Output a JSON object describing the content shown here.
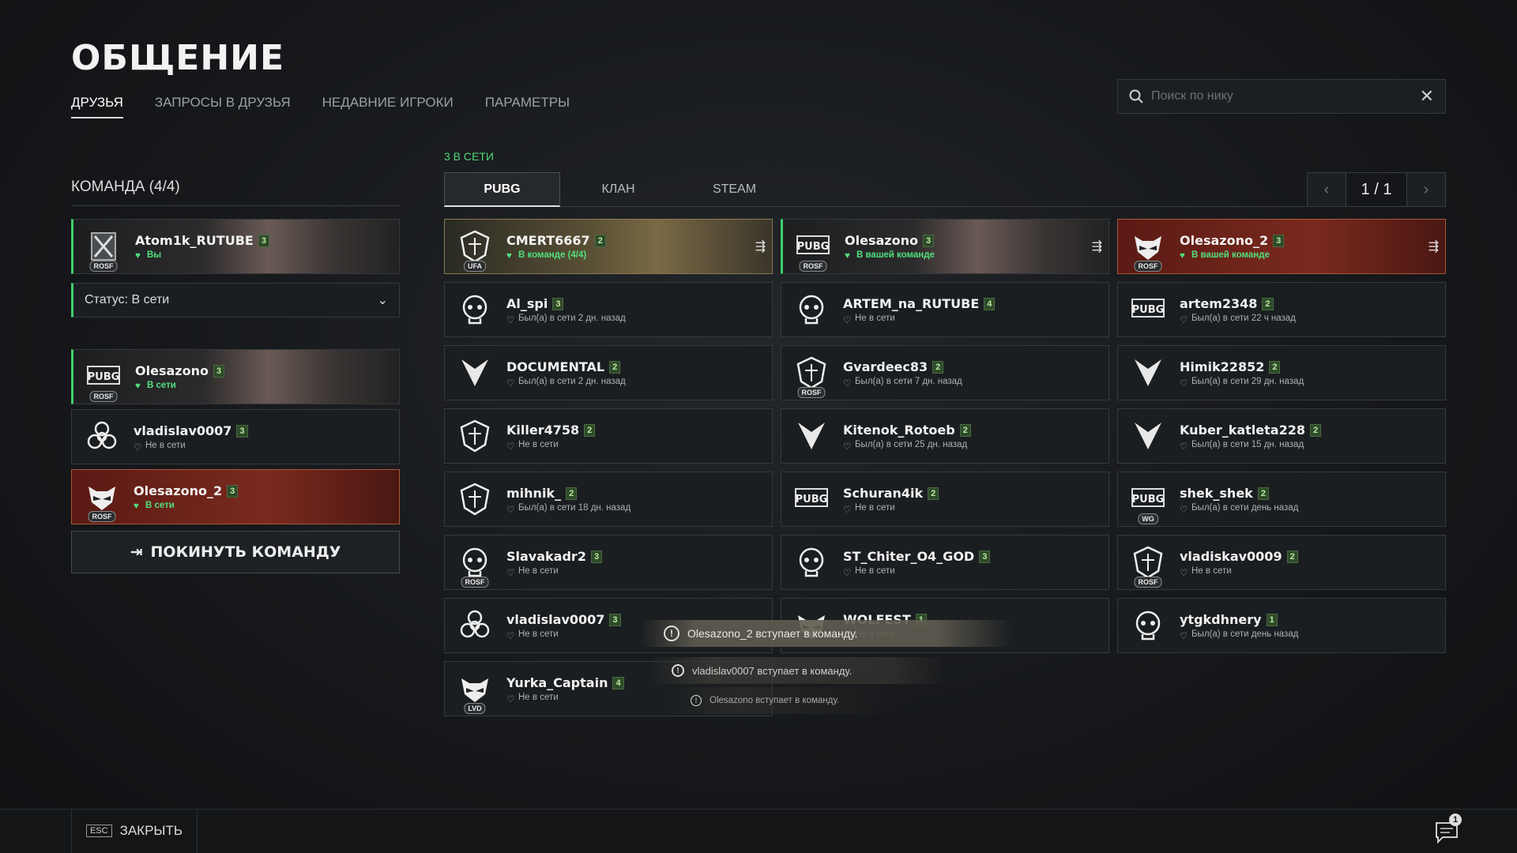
{
  "page": {
    "title": "ОБЩЕНИЕ",
    "tabs": [
      "ДРУЗЬЯ",
      "ЗАПРОСЫ В ДРУЗЬЯ",
      "НЕДАВНИЕ ИГРОКИ",
      "ПАРАМЕТРЫ"
    ],
    "active_tab": 0
  },
  "search": {
    "placeholder": "Поиск по нику"
  },
  "team": {
    "title": "КОМАНДА (4/4)",
    "self": {
      "name": "Atom1k_RUTUBE",
      "level": "3",
      "clan": "ROSF",
      "status": "Вы"
    },
    "status_select": "Статус: В сети",
    "members": [
      {
        "name": "Olesazono",
        "level": "3",
        "clan": "ROSF",
        "status": "В сети",
        "online": true
      },
      {
        "name": "vladislav0007",
        "level": "3",
        "clan": "",
        "status": "Не в сети",
        "online": false
      },
      {
        "name": "Olesazono_2",
        "level": "3",
        "clan": "ROSF",
        "status": "В сети",
        "online": true
      }
    ],
    "leave_label": "ПОКИНУТЬ КОМАНДУ"
  },
  "friends": {
    "online_count": "3 В СЕТИ",
    "subtabs": [
      "PUBG",
      "КЛАН",
      "STEAM"
    ],
    "page": "1 / 1",
    "list": [
      {
        "name": "CMERT6667",
        "level": "2",
        "clan": "UFA",
        "status": "В команде (4/4)",
        "online": true
      },
      {
        "name": "Olesazono",
        "level": "3",
        "clan": "ROSF",
        "status": "В вашей команде",
        "online": true
      },
      {
        "name": "Olesazono_2",
        "level": "3",
        "clan": "ROSF",
        "status": "В вашей команде",
        "online": true
      },
      {
        "name": "Al_spi",
        "level": "3",
        "clan": "",
        "status": "Был(а) в сети 2 дн. назад",
        "online": false
      },
      {
        "name": "ARTEM_na_RUTUBE",
        "level": "4",
        "clan": "",
        "status": "Не в сети",
        "online": false
      },
      {
        "name": "artem2348",
        "level": "2",
        "clan": "",
        "status": "Был(а) в сети 22 ч назад",
        "online": false
      },
      {
        "name": "DOCUMENTAL",
        "level": "2",
        "clan": "",
        "status": "Был(а) в сети 2 дн. назад",
        "online": false
      },
      {
        "name": "Gvardeec83",
        "level": "2",
        "clan": "ROSF",
        "status": "Был(а) в сети 7 дн. назад",
        "online": false
      },
      {
        "name": "Himik22852",
        "level": "2",
        "clan": "",
        "status": "Был(а) в сети 29 дн. назад",
        "online": false
      },
      {
        "name": "Killer4758",
        "level": "2",
        "clan": "",
        "status": "Не в сети",
        "online": false
      },
      {
        "name": "Kitenok_Rotoeb",
        "level": "2",
        "clan": "",
        "status": "Был(а) в сети 25 дн. назад",
        "online": false
      },
      {
        "name": "Kuber_katleta228",
        "level": "2",
        "clan": "",
        "status": "Был(а) в сети 15 дн. назад",
        "online": false
      },
      {
        "name": "mihnik_",
        "level": "2",
        "clan": "",
        "status": "Был(а) в сети 18 дн. назад",
        "online": false
      },
      {
        "name": "Schuran4ik",
        "level": "2",
        "clan": "",
        "status": "Не в сети",
        "online": false
      },
      {
        "name": "shek_shek",
        "level": "2",
        "clan": "WG",
        "status": "Был(а) в сети день назад",
        "online": false
      },
      {
        "name": "Slavakadr2",
        "level": "3",
        "clan": "ROSF",
        "status": "Не в сети",
        "online": false
      },
      {
        "name": "ST_Chiter_O4_GOD",
        "level": "3",
        "clan": "",
        "status": "Не в сети",
        "online": false
      },
      {
        "name": "vladiskav0009",
        "level": "2",
        "clan": "ROSF",
        "status": "Не в сети",
        "online": false
      },
      {
        "name": "vladislav0007",
        "level": "3",
        "clan": "",
        "status": "Не в сети",
        "online": false
      },
      {
        "name": "WOLFEST",
        "level": "1",
        "clan": "",
        "status": "Не в сети",
        "online": false
      },
      {
        "name": "ytgkdhnery",
        "level": "1",
        "clan": "",
        "status": "Был(а) в сети день назад",
        "online": false
      },
      {
        "name": "Yurka_Captain",
        "level": "4",
        "clan": "LVD",
        "status": "Не в сети",
        "online": false
      }
    ]
  },
  "notifications": [
    "Olesazono_2 вступает в команду.",
    "vladislav0007 вступает в команду.",
    "Olesazono вступает в команду."
  ],
  "footer": {
    "esc_key": "ESC",
    "close_label": "ЗАКРЫТЬ",
    "chat_count": "1"
  },
  "colors": {
    "online": "#3fcf6d",
    "accent_red": "#7a2a1e"
  }
}
